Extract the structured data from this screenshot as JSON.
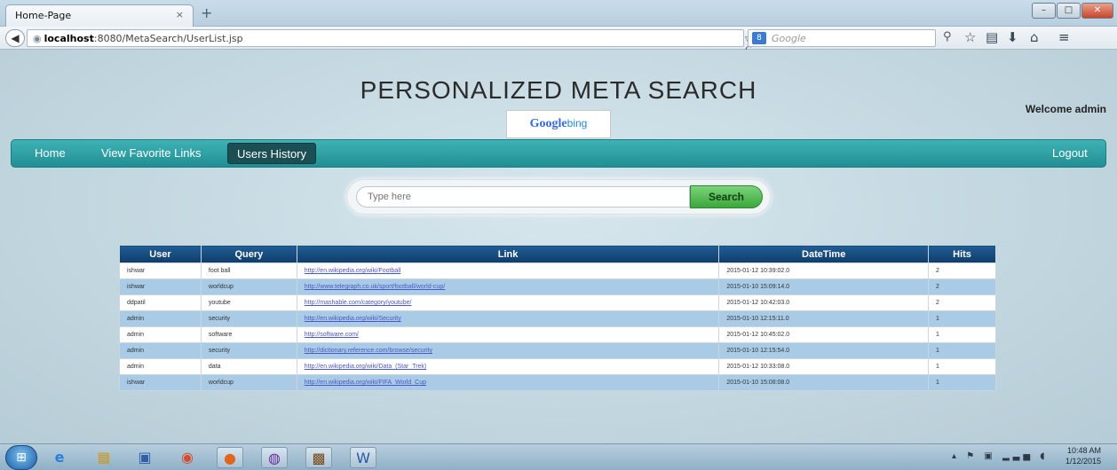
{
  "browser": {
    "tab_title": "Home-Page",
    "tab_close": "×",
    "new_tab": "+",
    "url_host": "localhost",
    "url_path": ":8080/MetaSearch/UserList.jsp",
    "search_engine_label": "8",
    "search_placeholder": "Google",
    "window_controls": {
      "minimize": "–",
      "maximize": "□",
      "close": "✕"
    }
  },
  "page": {
    "title": "PERSONALIZED META SEARCH",
    "logo": {
      "google": "Google",
      "bing": "bing"
    },
    "welcome": "Welcome admin"
  },
  "menu": {
    "home": "Home",
    "favorites": "View Favorite Links",
    "history": "Users History",
    "logout": "Logout"
  },
  "search": {
    "placeholder": "Type here",
    "button": "Search"
  },
  "table": {
    "headers": [
      "User",
      "Query",
      "Link",
      "DateTime",
      "Hits"
    ],
    "rows": [
      [
        "ishwar",
        "foot ball",
        "http://en.wikipedia.org/wiki/Football",
        "2015-01-12 10:39:02.0",
        "2"
      ],
      [
        "ishwar",
        "worldcup",
        "http://www.telegraph.co.uk/sport/football/world-cup/",
        "2015-01-10 15:09:14.0",
        "2"
      ],
      [
        "ddpatil",
        "youtube",
        "http://mashable.com/category/youtube/",
        "2015-01-12 10:42:03.0",
        "2"
      ],
      [
        "admin",
        "security",
        "http://en.wikipedia.org/wiki/Security",
        "2015-01-10 12:15:11.0",
        "1"
      ],
      [
        "admin",
        "software",
        "http://software.com/",
        "2015-01-12 10:45:02.0",
        "1"
      ],
      [
        "admin",
        "security",
        "http://dictionary.reference.com/browse/security",
        "2015-01-10 12:15:54.0",
        "1"
      ],
      [
        "admin",
        "data",
        "http://en.wikipedia.org/wiki/Data_(Star_Trek)",
        "2015-01-12 10:33:08.0",
        "1"
      ],
      [
        "ishwar",
        "worldcup",
        "http://en.wikipedia.org/wiki/FIFA_World_Cup",
        "2015-01-10 15:08:08.0",
        "1"
      ]
    ]
  },
  "taskbar": {
    "time": "10:48 AM",
    "date": "1/12/2015"
  }
}
